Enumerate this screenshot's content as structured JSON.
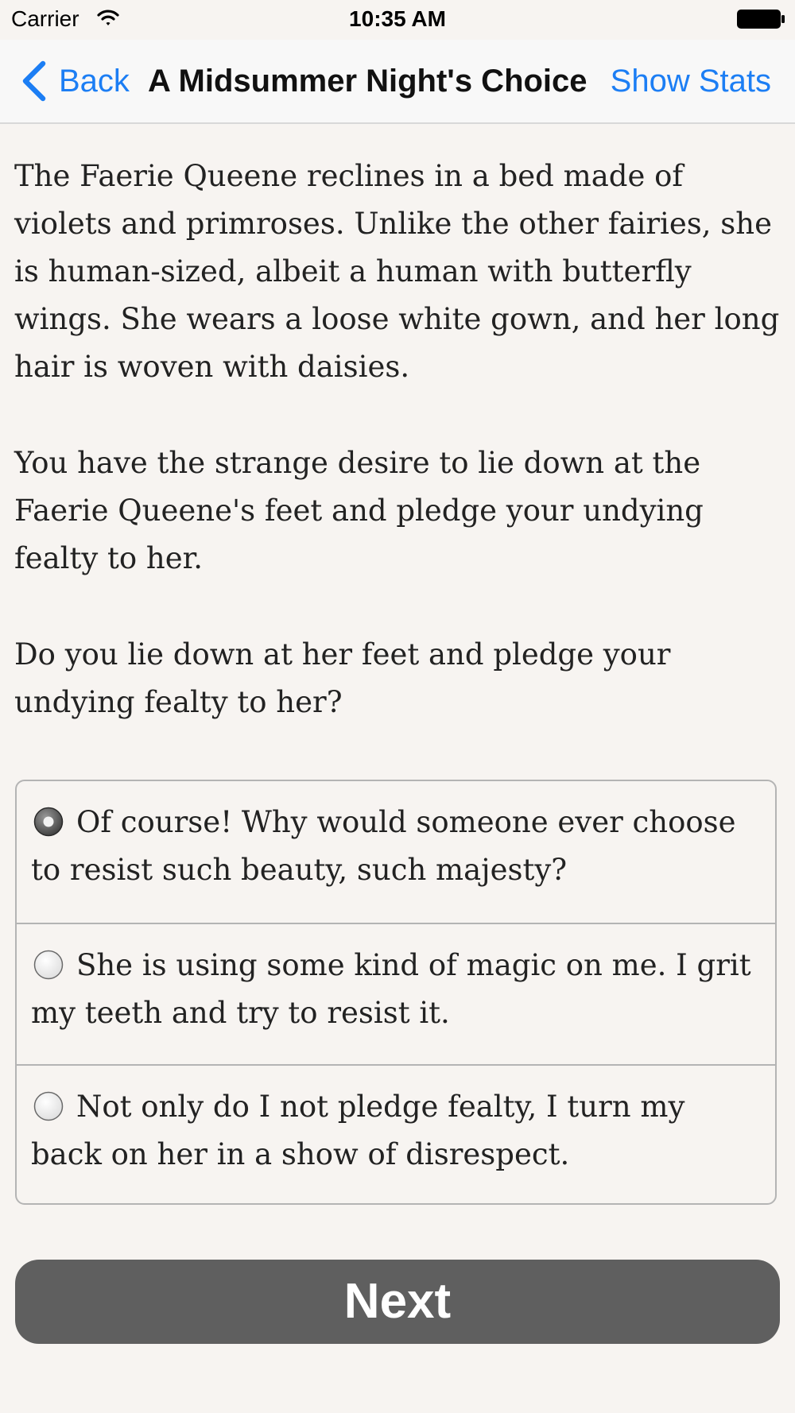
{
  "status_bar": {
    "carrier": "Carrier",
    "time": "10:35 AM",
    "wifi_icon": "wifi-icon",
    "battery_icon": "battery-icon"
  },
  "nav": {
    "back_label": "Back",
    "back_icon": "chevron-left-icon",
    "title": "A Midsummer Night's Choice",
    "right_button": "Show Stats",
    "accent_color": "#1c7ef4"
  },
  "content": {
    "paragraphs": [
      "The Faerie Queene reclines in a bed made of violets and primroses. Unlike the other fairies, she is human-sized, albeit a human with butterfly wings. She wears a loose white gown, and her long hair is woven with daisies.",
      "You have the strange desire to lie down at the Faerie Queene's feet and pledge your undying fealty to her.",
      "Do you lie down at her feet and pledge your undying fealty to her?"
    ]
  },
  "choices": [
    {
      "label": "Of course! Why would someone ever choose to resist such beauty, such majesty?",
      "selected": true
    },
    {
      "label": "She is using some kind of magic on me. I grit my teeth and try to resist it.",
      "selected": false
    },
    {
      "label": "Not only do I not pledge fealty, I turn my back on her in a show of disrespect.",
      "selected": false
    }
  ],
  "next_button": {
    "label": "Next",
    "color": "#5f5f5f"
  }
}
